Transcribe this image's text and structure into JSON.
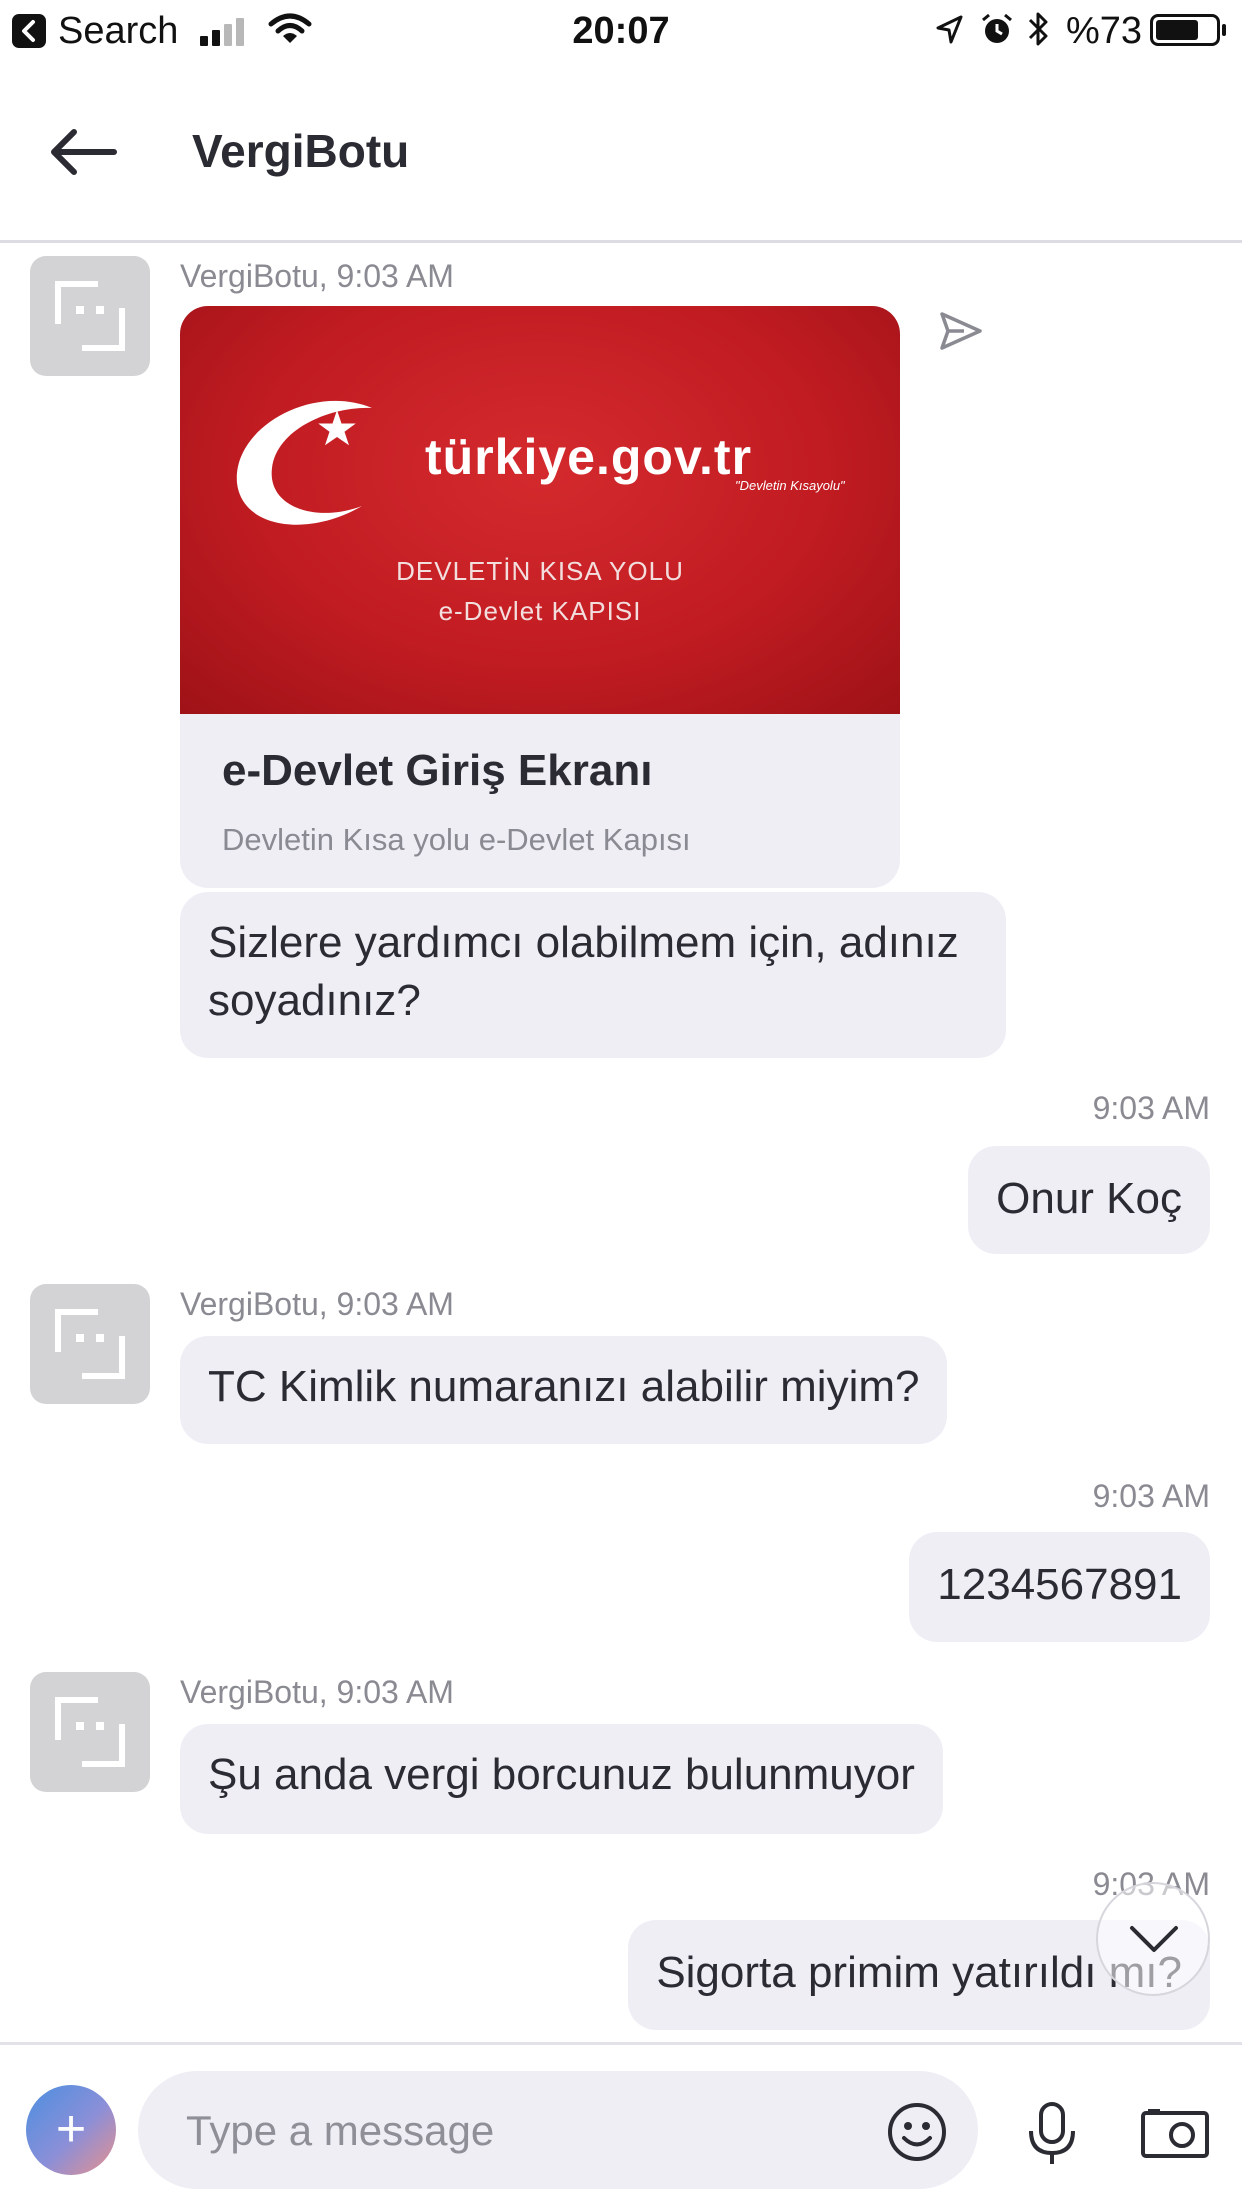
{
  "status_bar": {
    "back_app": "Search",
    "time": "20:07",
    "battery": "%73",
    "battery_level": 0.73
  },
  "header": {
    "back_icon": "arrow-left-icon",
    "title": "VergiBotu"
  },
  "messages": [
    {
      "type": "card",
      "meta": "VergiBotu, 9:03 AM",
      "image": {
        "brand": "türkiye.gov.tr",
        "slogan": "\"Devletin Kısayolu\"",
        "line1": "DEVLETİN KISA YOLU",
        "line2": "e-Devlet KAPISI"
      },
      "title": "e-Devlet Giriş Ekranı",
      "description": "Devletin Kısa yolu e-Devlet Kapısı"
    },
    {
      "type": "in",
      "text": "Sizlere yardımcı olabilmem için, adınız soyadınız?"
    },
    {
      "type": "out",
      "time": "9:03 AM",
      "text": "Onur Koç"
    },
    {
      "type": "in",
      "meta": "VergiBotu, 9:03 AM",
      "text": "TC Kimlik numaranızı alabilir miyim?"
    },
    {
      "type": "out",
      "time": "9:03 AM",
      "text": "1234567891"
    },
    {
      "type": "in",
      "meta": "VergiBotu, 9:03 AM",
      "text": "Şu anda vergi borcunuz bulunmuyor"
    },
    {
      "type": "out",
      "time": "9:03 AM",
      "text": "Sigorta primim yatırıldı mı?"
    }
  ],
  "composer": {
    "placeholder": "Type a message",
    "value": ""
  },
  "colors": {
    "bubble": "#efeef5",
    "card_red": "#c11c22",
    "meta_text": "#8a8a92"
  }
}
